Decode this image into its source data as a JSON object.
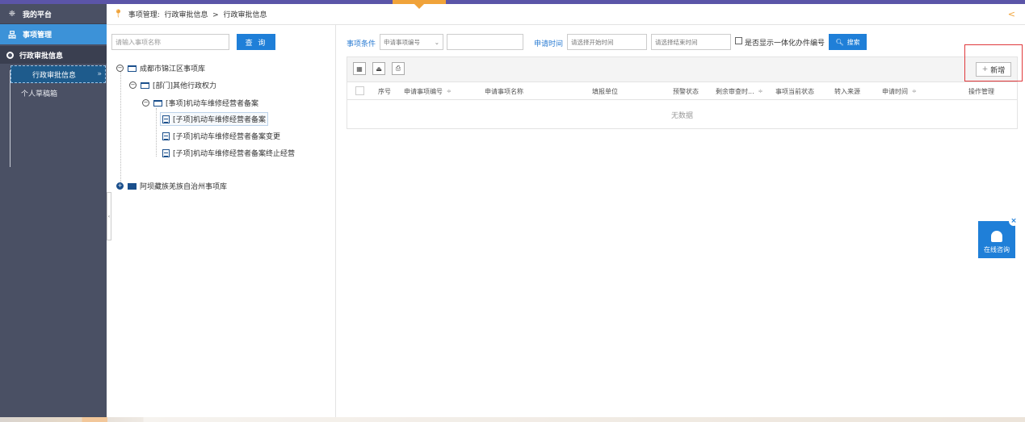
{
  "sidebar": {
    "platform_label": "我的平台",
    "matter_label": "事项管理",
    "section_label": "行政审批信息",
    "items": [
      {
        "label": "行政审批信息",
        "active": true
      },
      {
        "label": "个人草稿箱",
        "active": false
      }
    ],
    "active_arrow": "»"
  },
  "breadcrumb": {
    "text": "事项管理:  行政审批信息  >  行政审批信息",
    "collapse_glyph": "<"
  },
  "tree_panel": {
    "search_placeholder": "请输入事项名称",
    "query_label": "查 询",
    "nodes": [
      {
        "label": "成都市锦江区事项库"
      },
      {
        "label": "[部门]其他行政权力"
      },
      {
        "label": "[事项]机动车维修经营者备案"
      },
      {
        "label": "[子项]机动车维修经营者备案"
      },
      {
        "label": "[子项]机动车维修经营者备案变更"
      },
      {
        "label": "[子项]机动车维修经营者备案终止经营"
      },
      {
        "label": "阿坝藏族羌族自治州事项库"
      }
    ]
  },
  "filters": {
    "condition_label": "事项条件",
    "condition_select": "申请事项编号",
    "condition_value": "",
    "time_label": "申请时间",
    "start_placeholder": "请选择开始时间",
    "end_placeholder": "请选择结束时间",
    "checkbox_label": "是否显示一体化办件编号",
    "search_label": "搜索"
  },
  "toolbar": {
    "add_label": "新增"
  },
  "table": {
    "columns": [
      "序号",
      "申请事项编号",
      "申请事项名称",
      "填报单位",
      "预警状态",
      "剩余审查时...",
      "事项当前状态",
      "转入来源",
      "申请时间",
      "操作管理"
    ],
    "empty_text": "无数据"
  },
  "online_chat": {
    "label": "在线咨询"
  },
  "colors": {
    "sidebar_bg": "#4a5064",
    "accent_blue": "#1f7fd8",
    "active_matter": "#3c92d8",
    "accent_orange": "#f0a33a",
    "highlight_red": "#e0393c"
  }
}
